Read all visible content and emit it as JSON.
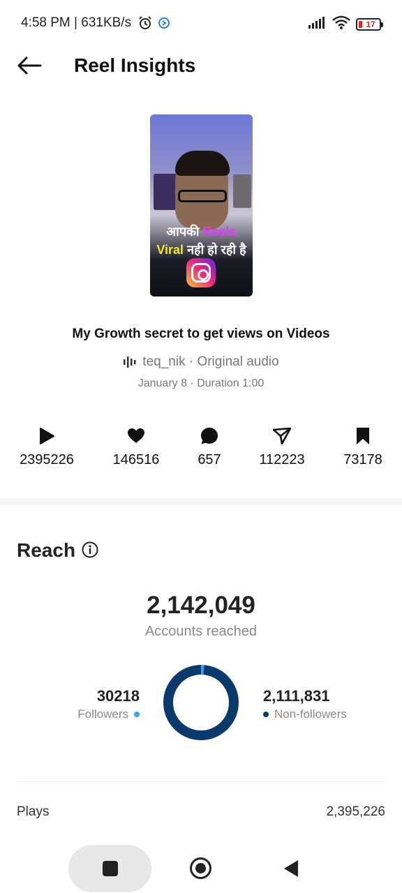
{
  "status_bar": {
    "time": "4:58 PM | 631KB/s",
    "battery": "17"
  },
  "app_bar": {
    "title": "Reel Insights"
  },
  "thumbnail": {
    "overlay_line1_a": "आपकी ",
    "overlay_line1_b": "Reels",
    "overlay_line2_a": "Viral",
    "overlay_line2_b": " नही हो रही है"
  },
  "reel": {
    "title": "My Growth secret to get views on Videos",
    "audio": "teq_nik · Original audio",
    "meta": "January 8 · Duration 1:00"
  },
  "stats": [
    {
      "icon": "play-icon",
      "value": "2395226"
    },
    {
      "icon": "heart-icon",
      "value": "146516"
    },
    {
      "icon": "comment-icon",
      "value": "657"
    },
    {
      "icon": "share-icon",
      "value": "112223"
    },
    {
      "icon": "bookmark-icon",
      "value": "73178"
    }
  ],
  "reach": {
    "title": "Reach",
    "total": "2,142,049",
    "total_label": "Accounts reached",
    "followers_value": "30218",
    "followers_label": "Followers",
    "non_followers_value": "2,111,831",
    "non_followers_label": "Non-followers",
    "followers_fraction": 0.014,
    "followers_color": "#3ba2e8",
    "non_followers_color": "#0a3a6b"
  },
  "plays": {
    "label": "Plays",
    "value": "2,395,226"
  }
}
